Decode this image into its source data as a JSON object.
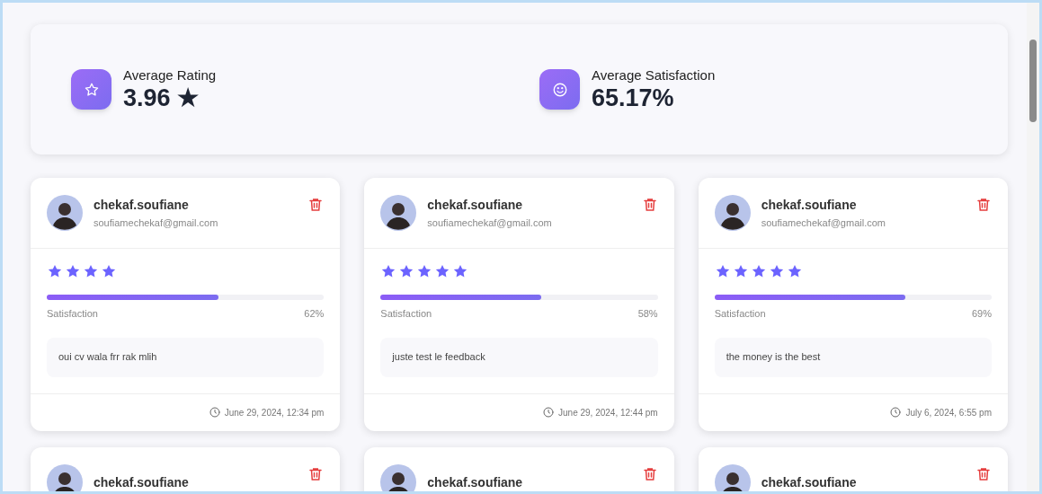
{
  "stats": [
    {
      "kind": "rating",
      "label": "Average Rating",
      "value": "3.96 ★"
    },
    {
      "kind": "satisfaction",
      "label": "Average Satisfaction",
      "value": "65.17%"
    }
  ],
  "feedbacks": [
    {
      "name": "chekaf.soufiane",
      "email": "soufiamechekaf@gmail.com",
      "stars": 4,
      "level": 0.62,
      "satisfaction_label": "Satisfaction",
      "satisfaction": "62%",
      "comment": "oui cv wala frr rak mlih",
      "date": "June 29, 2024, 12:34 pm"
    },
    {
      "name": "chekaf.soufiane",
      "email": "soufiamechekaf@gmail.com",
      "stars": 5,
      "level": 0.58,
      "satisfaction_label": "Satisfaction",
      "satisfaction": "58%",
      "comment": "juste test le feedback",
      "date": "June 29, 2024, 12:44 pm"
    },
    {
      "name": "chekaf.soufiane",
      "email": "soufiamechekaf@gmail.com",
      "stars": 5,
      "level": 0.69,
      "satisfaction_label": "Satisfaction",
      "satisfaction": "69%",
      "comment": "the money is the best",
      "date": "July 6, 2024, 6:55 pm"
    },
    {
      "name": "chekaf.soufiane"
    },
    {
      "name": "chekaf.soufiane"
    },
    {
      "name": "chekaf.soufiane"
    }
  ]
}
